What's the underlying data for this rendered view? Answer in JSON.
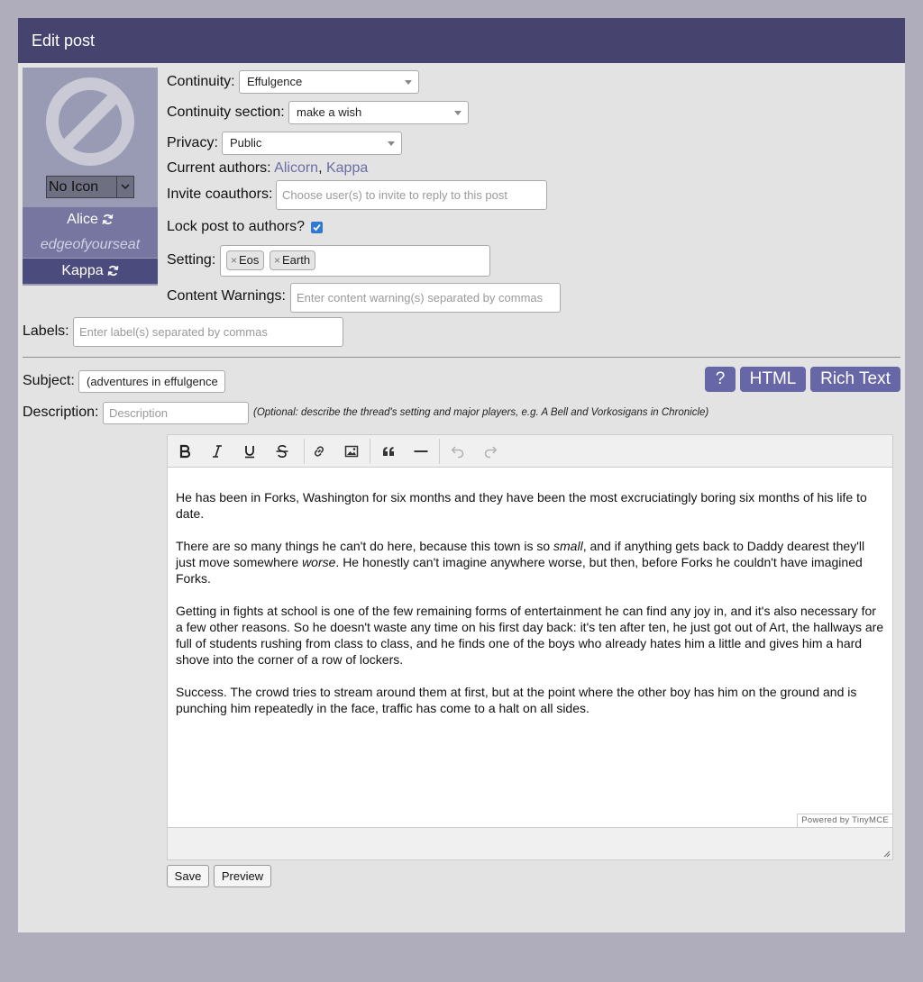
{
  "header": {
    "title": "Edit post"
  },
  "character": {
    "icon_select": "No Icon",
    "name": "Alice",
    "screenname": "edgeofyourseat",
    "other_name": "Kappa"
  },
  "form": {
    "continuity_label": "Continuity:",
    "continuity_value": "Effulgence",
    "section_label": "Continuity section:",
    "section_value": "make a wish",
    "privacy_label": "Privacy:",
    "privacy_value": "Public",
    "authors_label": "Current authors:",
    "authors": [
      "Alicorn",
      "Kappa"
    ],
    "authors_sep": ",",
    "coauthors_label": "Invite coauthors:",
    "coauthors_placeholder": "Choose user(s) to invite to reply to this post",
    "lock_label": "Lock post to authors?",
    "lock_checked": true,
    "setting_label": "Setting:",
    "setting_tags": [
      "Eos",
      "Earth"
    ],
    "warnings_label": "Content Warnings:",
    "warnings_placeholder": "Enter content warning(s) separated by commas",
    "labels_label": "Labels:",
    "labels_placeholder": "Enter label(s) separated by commas",
    "subject_label": "Subject:",
    "subject_value": "(adventures in effulgence",
    "description_label": "Description:",
    "description_placeholder": "Description",
    "description_hint": "(Optional: describe the thread's setting and major players, e.g. A Bell and Vorkosigans in Chronicle)"
  },
  "editor_modes": {
    "help": "?",
    "html": "HTML",
    "rich": "Rich Text"
  },
  "editor": {
    "powered_by": "Powered by TinyMCE",
    "paragraphs": [
      [
        {
          "t": "He has been in Forks, Washington for six months and they have been the most excruciatingly boring six months of his life to date."
        }
      ],
      [
        {
          "t": "There are so many things he can't do here, because this town is so "
        },
        {
          "t": "small",
          "i": true
        },
        {
          "t": ", and if anything gets back to Daddy dearest they'll just move somewhere "
        },
        {
          "t": "worse",
          "i": true
        },
        {
          "t": ". He honestly can't imagine anywhere worse, but then, before Forks he couldn't have imagined Forks."
        }
      ],
      [
        {
          "t": "Getting in fights at school is one of the few remaining forms of entertainment he can find any joy in, and it's also necessary for a few other reasons. So he doesn't waste any time on his first day back: it's ten after ten, he just got out of Art, the hallways are full of students rushing from class to class, and he finds one of the boys who already hates him a little and gives him a hard shove into the corner of a row of lockers."
        }
      ],
      [
        {
          "t": "Success. The crowd tries to stream around them at first, but at the point where the other boy has him on the ground and is punching him repeatedly in the face, traffic has come to a halt on all sides."
        }
      ]
    ]
  },
  "actions": {
    "save": "Save",
    "preview": "Preview"
  },
  "colors": {
    "header": "#46446f",
    "accent": "#6767a8",
    "link": "#6c6ca6"
  }
}
